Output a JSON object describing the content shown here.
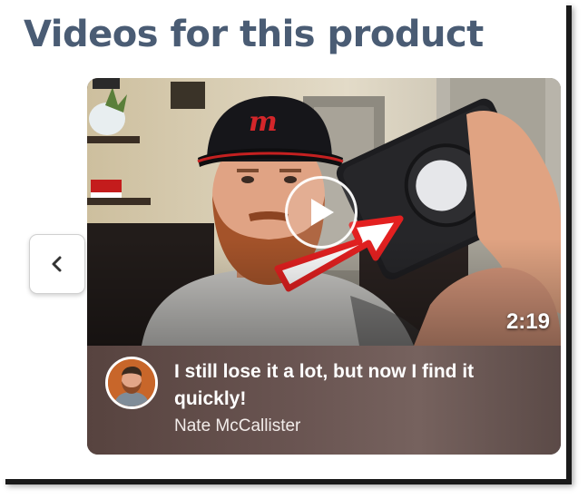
{
  "section": {
    "title": "Videos for this product"
  },
  "carousel": {
    "prev_icon": "chevron-left-icon"
  },
  "video": {
    "duration": "2:19",
    "play_icon": "play-icon",
    "caption": "I still lose it a lot, but now I find it quickly!",
    "author": "Nate McCallister"
  },
  "colors": {
    "title": "#4a5c74",
    "info_bar": "#6a5552",
    "arrow_red": "#e32020"
  }
}
